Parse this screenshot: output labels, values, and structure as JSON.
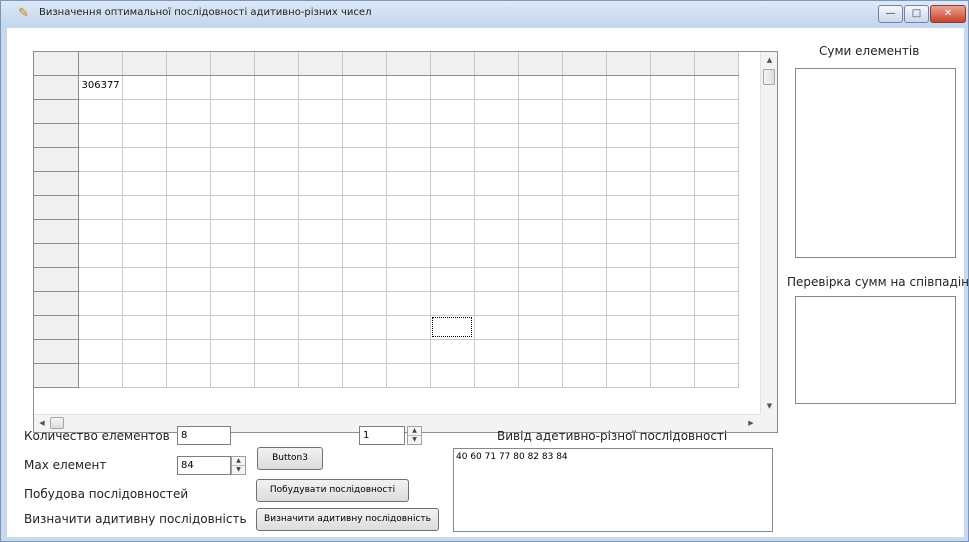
{
  "window": {
    "title": "Визначення оптимальної послідовності адитивно-різних чисел",
    "min_glyph": "—",
    "max_glyph": "□",
    "close_glyph": "✕"
  },
  "grid": {
    "rows": 14,
    "cols": 16,
    "cell_value": "306377",
    "cell_row": 1,
    "cell_col": 1,
    "focus_row": 11,
    "focus_col": 9
  },
  "sums_panel": {
    "label": "Суми елементів"
  },
  "check_panel": {
    "label": "Перевірка сумм на співпадіння"
  },
  "count": {
    "label": "Количество елементов",
    "value": "8"
  },
  "spinner": {
    "value": "1"
  },
  "max": {
    "label": "Max елемент",
    "value": "84"
  },
  "build": {
    "label": "Побудова послідовностей",
    "button": "Побудувати послідовності"
  },
  "determine": {
    "label": "Визначити адитивну послідовність",
    "button": "Визначити адитивну послідовність"
  },
  "button3": {
    "label": "Button3"
  },
  "output": {
    "label": "Вивід адетивно-різної послідовності",
    "text": "40 60 71 77 80 82 83 84"
  }
}
